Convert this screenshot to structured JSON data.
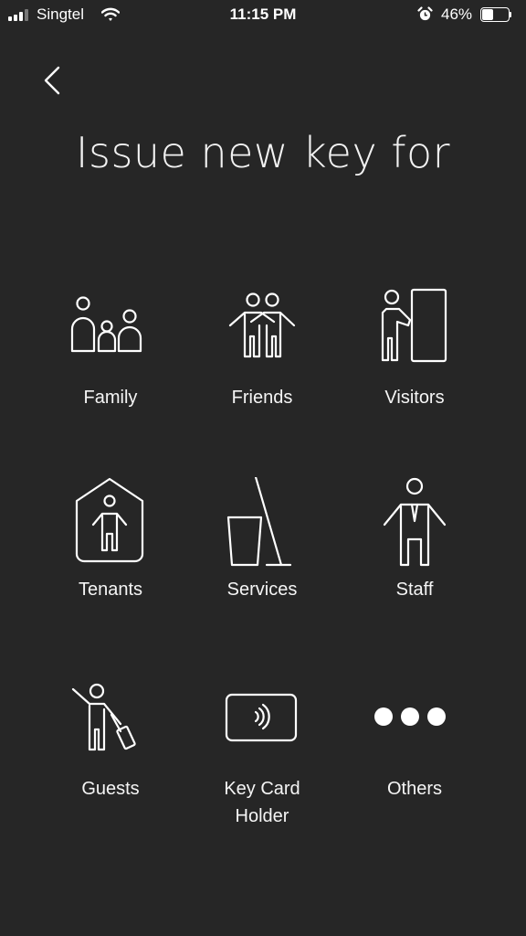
{
  "status_bar": {
    "carrier": "Singtel",
    "time": "11:15 PM",
    "battery_percent": "46%",
    "battery_level": 0.46
  },
  "title": "Issue new key for",
  "options": [
    {
      "label": "Family",
      "icon": "family-icon"
    },
    {
      "label": "Friends",
      "icon": "friends-icon"
    },
    {
      "label": "Visitors",
      "icon": "visitor-icon"
    },
    {
      "label": "Tenants",
      "icon": "tenant-icon"
    },
    {
      "label": "Services",
      "icon": "cleaning-services-icon"
    },
    {
      "label": "Staff",
      "icon": "staff-icon"
    },
    {
      "label": "Guests",
      "icon": "guest-luggage-icon"
    },
    {
      "label": "Key Card Holder",
      "icon": "key-card-icon"
    },
    {
      "label": "Others",
      "icon": "more-dots-icon"
    }
  ]
}
